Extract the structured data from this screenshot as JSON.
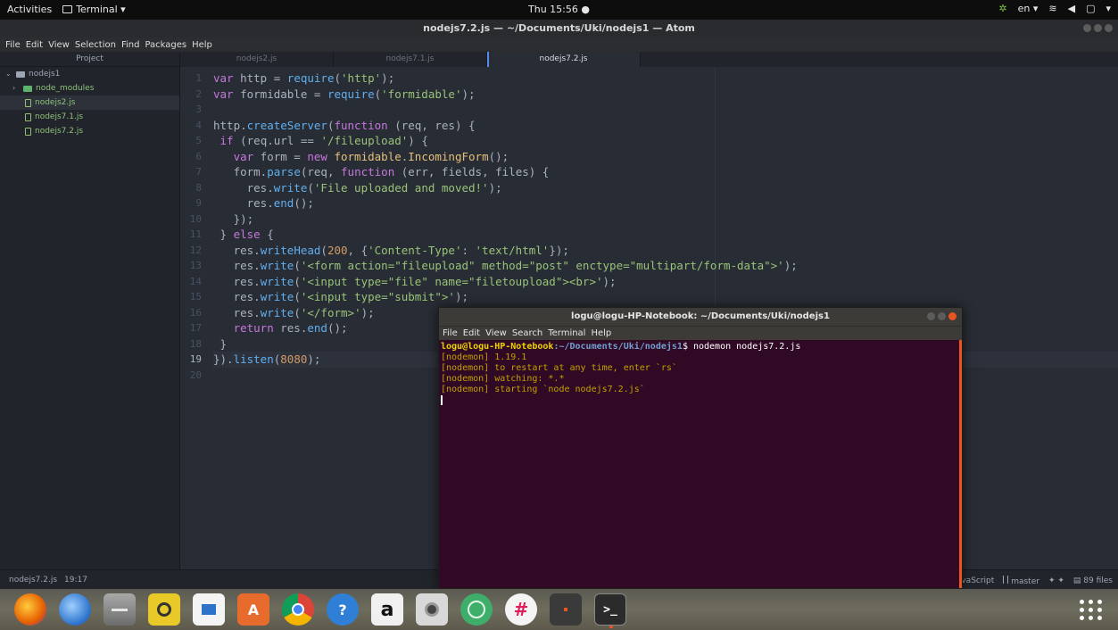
{
  "topbar": {
    "activities": "Activities",
    "app_menu": "Terminal ▾",
    "clock": "Thu 15:56 ●",
    "lang": "en ▾",
    "system": "▾"
  },
  "atom": {
    "window_title": "nodejs7.2.js — ~/Documents/Uki/nodejs1 — Atom",
    "menu": [
      "File",
      "Edit",
      "View",
      "Selection",
      "Find",
      "Packages",
      "Help"
    ]
  },
  "treeview": {
    "header": "Project",
    "root": "nodejs1",
    "items": [
      {
        "label": "node_modules",
        "type": "folder"
      },
      {
        "label": "nodejs2.js",
        "type": "file",
        "selected": true
      },
      {
        "label": "nodejs7.1.js",
        "type": "file"
      },
      {
        "label": "nodejs7.2.js",
        "type": "file"
      }
    ]
  },
  "tabs": [
    {
      "label": "nodejs2.js"
    },
    {
      "label": "nodejs7.1.js"
    },
    {
      "label": "nodejs7.2.js",
      "active": true
    }
  ],
  "editor": {
    "line_numbers": [
      "1",
      "2",
      "3",
      "4",
      "5",
      "6",
      "7",
      "8",
      "9",
      "10",
      "11",
      "12",
      "13",
      "14",
      "15",
      "16",
      "17",
      "18",
      "19",
      "20"
    ],
    "current_line": 19
  },
  "statusbar": {
    "file": "nodejs7.2.js",
    "cursor": "19:17",
    "grammar": "JavaScript",
    "branch": "master",
    "sync": "✦ ✦",
    "files": "89 files"
  },
  "terminal": {
    "title": "logu@logu-HP-Notebook: ~/Documents/Uki/nodejs1",
    "menu": [
      "File",
      "Edit",
      "View",
      "Search",
      "Terminal",
      "Help"
    ],
    "prompt_user": "logu@logu-HP-Notebook",
    "prompt_path": ":~/Documents/Uki/nodejs1",
    "prompt_cmd": "$ nodemon nodejs7.2.js",
    "output": [
      "[nodemon] 1.19.1",
      "[nodemon] to restart at any time, enter `rs`",
      "[nodemon] watching: *.*",
      "[nodemon] starting `node nodejs7.2.js`"
    ]
  },
  "dock": {
    "apps": [
      {
        "name": "firefox-icon",
        "color": "#e66000"
      },
      {
        "name": "thunderbird-icon",
        "color": "#2a6fc9"
      },
      {
        "name": "files-icon",
        "color": "#8a8a8a"
      },
      {
        "name": "rhythmbox-icon",
        "color": "#e0c020"
      },
      {
        "name": "libreoffice-writer-icon",
        "color": "#2f73c8"
      },
      {
        "name": "ubuntu-software-icon",
        "color": "#e86b2e",
        "glyph": "A"
      },
      {
        "name": "chrome-icon",
        "color": "#db4437"
      },
      {
        "name": "help-icon",
        "color": "#2f7fd6",
        "glyph": "?"
      },
      {
        "name": "amazon-icon",
        "color": "#f0f0f0",
        "glyph": "a"
      },
      {
        "name": "camera-icon",
        "color": "#cfcfcf"
      },
      {
        "name": "atom-icon",
        "color": "#3fae6a"
      },
      {
        "name": "slack-icon",
        "color": "#f4f4f4"
      },
      {
        "name": "device-icon",
        "color": "#3a3a3a"
      },
      {
        "name": "terminal-icon",
        "color": "#2b2b2b",
        "glyph": ">_",
        "active": true
      }
    ]
  }
}
